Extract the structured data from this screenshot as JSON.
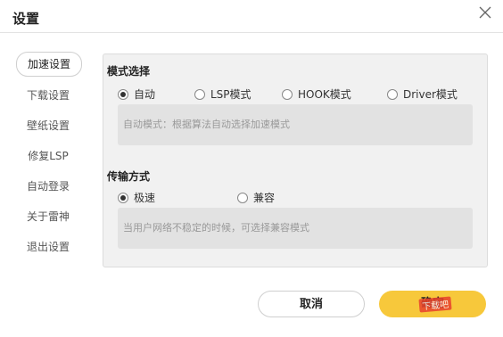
{
  "window": {
    "title": "设置"
  },
  "sidebar": {
    "items": [
      {
        "label": "加速设置",
        "active": true
      },
      {
        "label": "下载设置"
      },
      {
        "label": "壁纸设置"
      },
      {
        "label": "修复LSP"
      },
      {
        "label": "自动登录"
      },
      {
        "label": "关于雷神"
      },
      {
        "label": "退出设置"
      }
    ]
  },
  "mode": {
    "title": "模式选择",
    "options": [
      {
        "label": "自动",
        "selected": true
      },
      {
        "label": "LSP模式"
      },
      {
        "label": "HOOK模式"
      },
      {
        "label": "Driver模式"
      }
    ],
    "description": "自动模式：根据算法自动选择加速模式"
  },
  "transfer": {
    "title": "传输方式",
    "options": [
      {
        "label": "极速",
        "selected": true
      },
      {
        "label": "兼容"
      }
    ],
    "description": "当用户网络不稳定的时候，可选择兼容模式"
  },
  "buttons": {
    "cancel": "取消",
    "ok": "确定"
  },
  "watermark": "下载吧",
  "colors": {
    "accent": "#f7c83b",
    "panel": "#f1f1f1"
  }
}
